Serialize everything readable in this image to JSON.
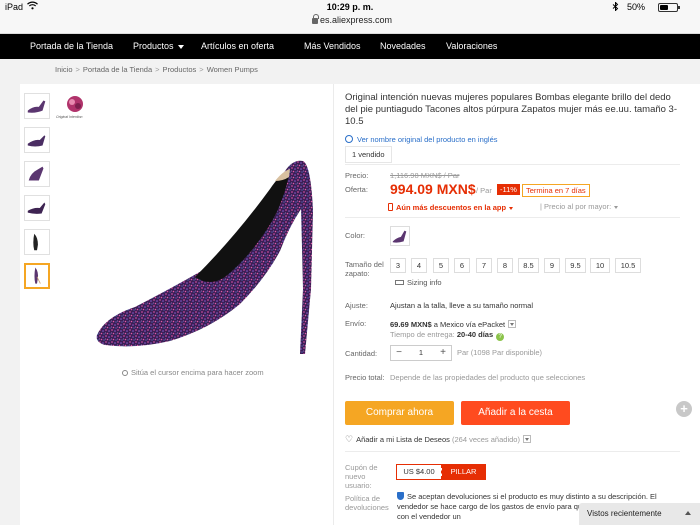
{
  "status_bar": {
    "device": "iPad",
    "time": "10:29 p. m.",
    "battery": "50%",
    "battery_level": 0.5
  },
  "browser": {
    "url": "es.aliexpress.com"
  },
  "nav": {
    "items": [
      {
        "label": "Portada de la Tienda"
      },
      {
        "label": "Productos"
      },
      {
        "label": "Artículos en oferta"
      },
      {
        "label": "Más Vendidos"
      },
      {
        "label": "Novedades"
      },
      {
        "label": "Valoraciones"
      }
    ]
  },
  "breadcrumb": [
    "Inicio",
    "Portada de la Tienda",
    "Productos",
    "Women Pumps"
  ],
  "gallery": {
    "logo_text": "Original Intention",
    "zoom_hint": "Sitúa el cursor encima para hacer zoom",
    "thumbnail_count": 6,
    "active_thumbnail": 6
  },
  "product": {
    "title": "Original intención nuevas mujeres populares Bombas elegante brillo del dedo del pie puntiagudo Tacones altos púrpura Zapatos mujer más ee.uu. tamaño 3-10.5",
    "original_link": "Ver nombre original del producto en inglés",
    "sold": "1 vendido"
  },
  "pricing": {
    "price_label": "Precio:",
    "old_price": "1,116.98 MXN$ / Par",
    "offer_label": "Oferta:",
    "new_price": "994.09 MXN$",
    "per_unit": "/ Par",
    "discount": "-11%",
    "ends": "Termina en 7 días",
    "app_discount": "Aún más descuentos en la app",
    "bulk_price": "Precio al por mayor:"
  },
  "options": {
    "color_label": "Color:",
    "size_label": "Tamaño del zapato:",
    "sizes": [
      "3",
      "4",
      "5",
      "6",
      "7",
      "8",
      "8.5",
      "9",
      "9.5",
      "10",
      "10.5"
    ],
    "sizing_info": "Sizing info",
    "fit_label": "Ajuste:",
    "fit_value": "Ajustan a la talla, lleve a su tamaño normal",
    "shipping_label": "Envío:",
    "shipping_price": "69.69 MXN$",
    "shipping_rest": " a Mexico vía ePacket",
    "delivery_label": "Tiempo de entrega:",
    "delivery_value": "20-40 días",
    "quantity_label": "Cantidad:",
    "quantity": "1",
    "available": "Par (1098 Par disponible)",
    "total_label": "Precio total:",
    "total_value": "Depende de las propiedades del producto que selecciones"
  },
  "actions": {
    "buy_now": "Comprar ahora",
    "add_to_cart": "Añadir a la cesta",
    "wishlist": "Añadir a mi Lista de Deseos",
    "wishlist_count": "(264 veces añadido)"
  },
  "coupon": {
    "label": "Cupón de nuevo usuario:",
    "amount": "US $4.00",
    "button": "PILLAR"
  },
  "returns": {
    "label": "Política de devoluciones",
    "text": "Se aceptan devoluciones si el producto es muy distinto a su descripción. El vendedor se hace cargo de los gastos de envío para quedarte el producto y acordar con el vendedor un"
  },
  "recent": {
    "label": "Vistos recientemente"
  },
  "colors": {
    "nav_bg": "#000000",
    "price": "#e62e04",
    "buy": "#f5a623",
    "cart": "#ff4b1f",
    "link": "#2a6fc9"
  }
}
